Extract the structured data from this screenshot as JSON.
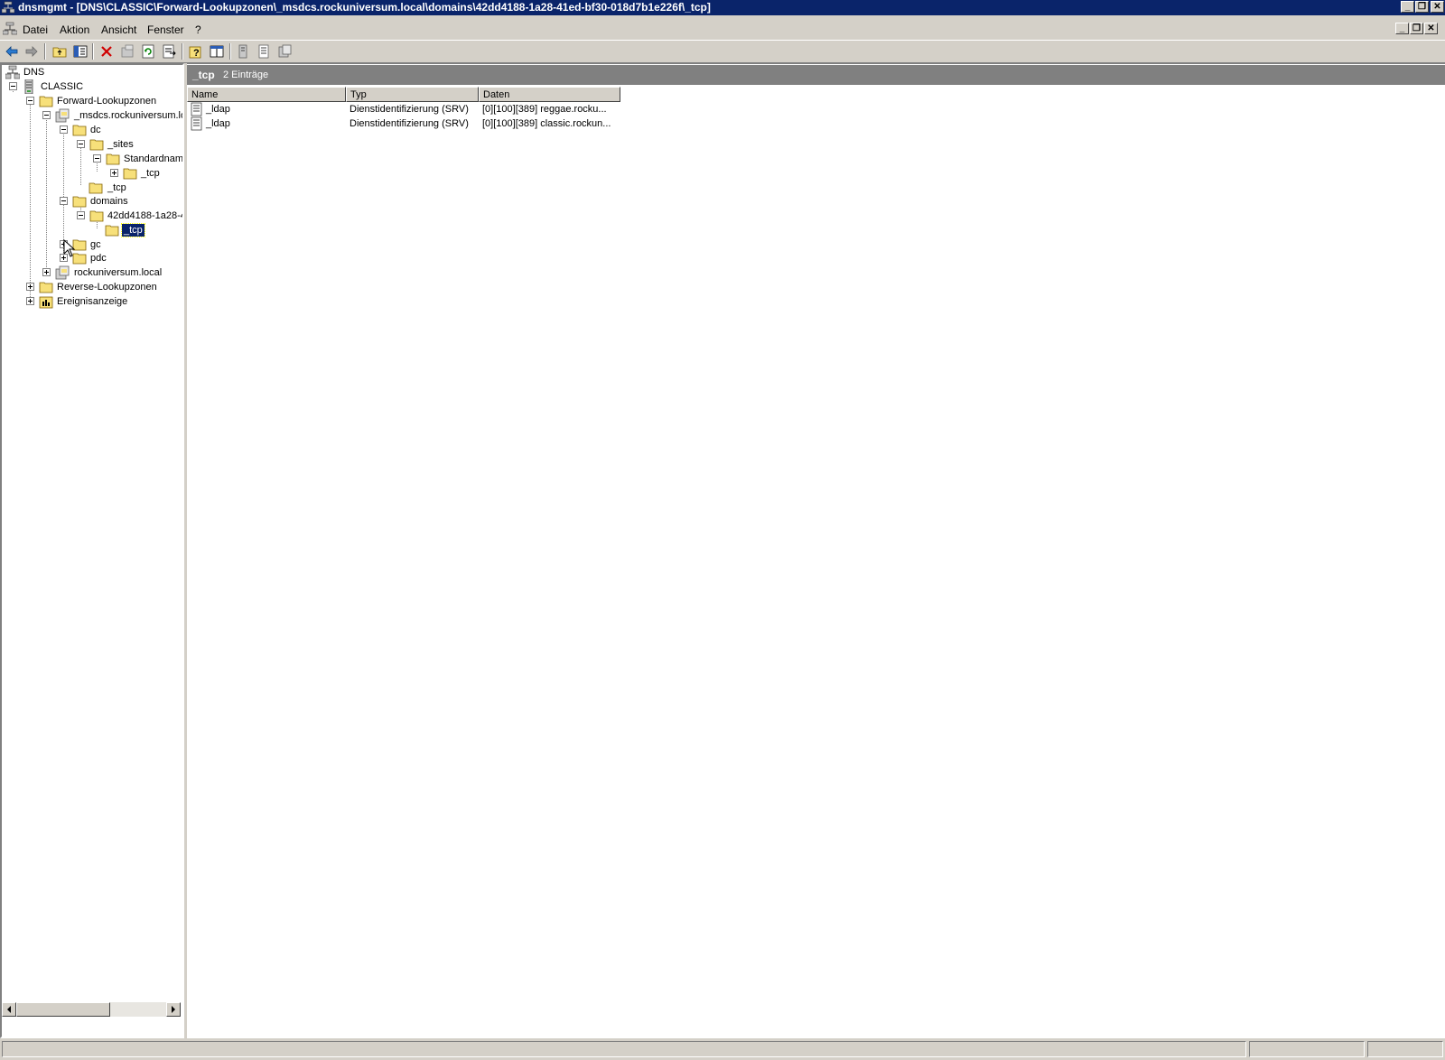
{
  "window": {
    "title": "dnsmgmt - [DNS\\CLASSIC\\Forward-Lookupzonen\\_msdcs.rockuniversum.local\\domains\\42dd4188-1a28-41ed-bf30-018d7b1e226f\\_tcp]",
    "minimize_glyph": "_",
    "restore_glyph": "❐",
    "close_glyph": "✕"
  },
  "menu": {
    "items": [
      "Datei",
      "Aktion",
      "Ansicht",
      "Fenster",
      "?"
    ]
  },
  "toolbar": {
    "buttons": [
      "back-icon",
      "forward-icon",
      "up-folder-icon",
      "show-hide-tree-icon",
      "delete-icon",
      "properties-icon",
      "refresh-icon",
      "export-list-icon",
      "help-icon",
      "show-console-tree-icon",
      "record-icon",
      "list-icon",
      "zone-icon"
    ]
  },
  "tree": {
    "nodes": [
      {
        "label": "DNS",
        "icon": "dns-root-icon",
        "expander": "none"
      },
      {
        "label": "CLASSIC",
        "icon": "server-icon",
        "expander": "minus"
      },
      {
        "label": "Forward-Lookupzonen",
        "icon": "folder-icon",
        "expander": "minus"
      },
      {
        "label": "_msdcs.rockuniversum.lo",
        "icon": "zone-icon",
        "expander": "minus"
      },
      {
        "label": "dc",
        "icon": "folder-icon",
        "expander": "minus"
      },
      {
        "label": "_sites",
        "icon": "folder-icon",
        "expander": "minus"
      },
      {
        "label": "Standardnam",
        "icon": "folder-icon",
        "expander": "minus"
      },
      {
        "label": "_tcp",
        "icon": "folder-icon",
        "expander": "plus"
      },
      {
        "label": "_tcp",
        "icon": "folder-icon",
        "expander": "none"
      },
      {
        "label": "domains",
        "icon": "folder-icon",
        "expander": "minus"
      },
      {
        "label": "42dd4188-1a28-4",
        "icon": "folder-icon",
        "expander": "minus"
      },
      {
        "label": "_tcp",
        "icon": "folder-icon",
        "expander": "none",
        "selected": true
      },
      {
        "label": "gc",
        "icon": "folder-icon",
        "expander": "plus"
      },
      {
        "label": "pdc",
        "icon": "folder-icon",
        "expander": "plus"
      },
      {
        "label": "rockuniversum.local",
        "icon": "zone-icon",
        "expander": "plus"
      },
      {
        "label": "Reverse-Lookupzonen",
        "icon": "folder-icon",
        "expander": "plus"
      },
      {
        "label": "Ereignisanzeige",
        "icon": "event-viewer-icon",
        "expander": "plus"
      }
    ]
  },
  "result": {
    "title": "_tcp",
    "count": "2 Einträge",
    "columns": [
      "Name",
      "Typ",
      "Daten"
    ],
    "rows": [
      {
        "name": "_ldap",
        "type": "Dienstidentifizierung (SRV)",
        "data": "[0][100][389] reggae.rocku..."
      },
      {
        "name": "_ldap",
        "type": "Dienstidentifizierung (SRV)",
        "data": "[0][100][389] classic.rockun..."
      }
    ]
  },
  "colors": {
    "titlebar": "#0a246a",
    "chrome": "#d4d0c8",
    "result_header": "#808080",
    "folder": "#f7e07a"
  }
}
